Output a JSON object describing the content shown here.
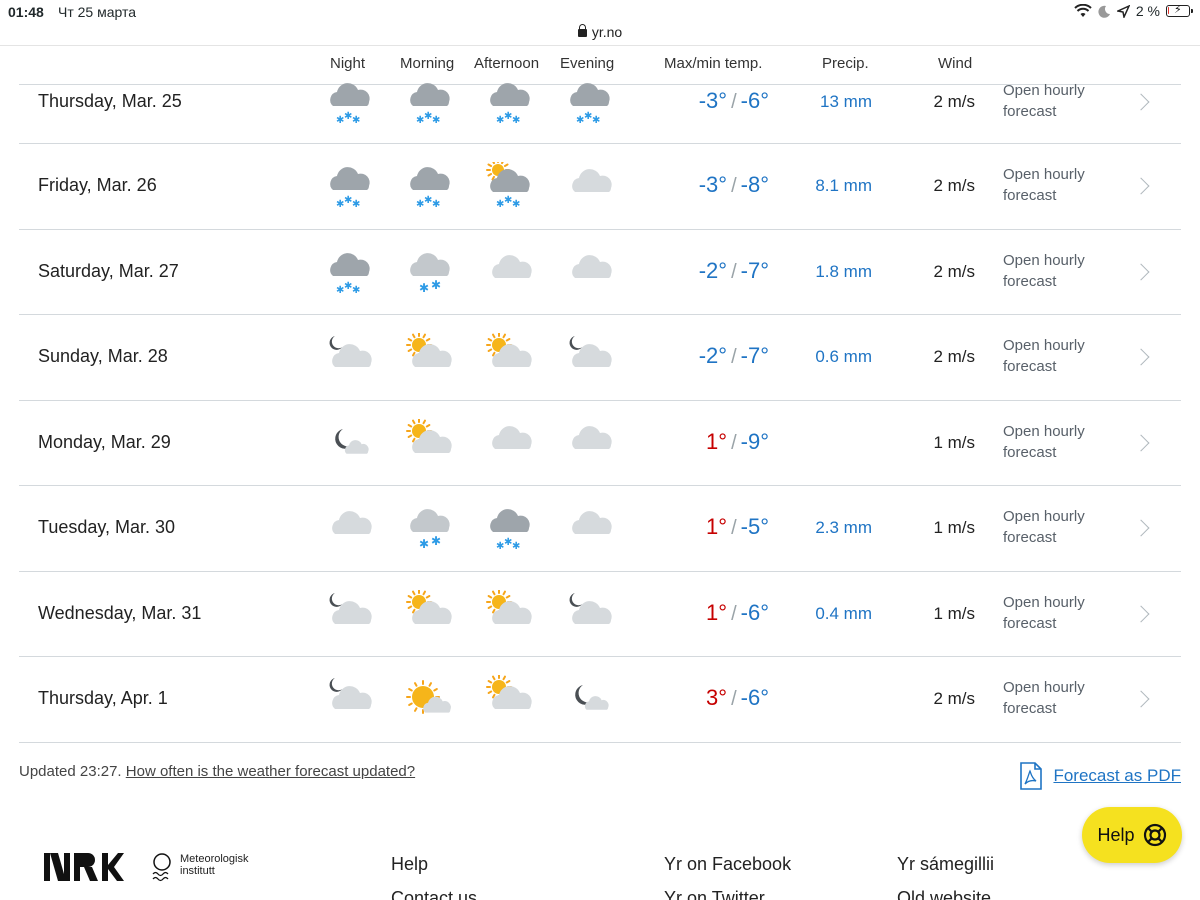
{
  "status": {
    "time": "01:48",
    "date": "Чт 25 марта",
    "battery": "2 %",
    "battery_level": 0.02,
    "url": "yr.no"
  },
  "columns": {
    "night": "Night",
    "morning": "Morning",
    "afternoon": "Afternoon",
    "evening": "Evening",
    "temp": "Max/min temp.",
    "precip": "Precip.",
    "wind": "Wind"
  },
  "rows": [
    {
      "day": "Thursday, Mar. 25",
      "icons": [
        "snow-cloud-icon",
        "snow-cloud-icon",
        "snow-cloud-icon",
        "snow-cloud-icon"
      ],
      "max": "-3°",
      "min": "-6°",
      "max_warm": false,
      "precip": "13 mm",
      "wind": "2 m/s",
      "link1": "Open hourly",
      "link2": "forecast"
    },
    {
      "day": "Friday, Mar. 26",
      "icons": [
        "snow-cloud-icon",
        "snow-cloud-icon",
        "sun-snow-cloud-icon",
        "cloud-icon"
      ],
      "max": "-3°",
      "min": "-8°",
      "max_warm": false,
      "precip": "8.1 mm",
      "wind": "2 m/s",
      "link1": "Open hourly",
      "link2": "forecast"
    },
    {
      "day": "Saturday, Mar. 27",
      "icons": [
        "snow-cloud-icon",
        "light-snow-cloud-icon",
        "cloud-icon",
        "cloud-icon"
      ],
      "max": "-2°",
      "min": "-7°",
      "max_warm": false,
      "precip": "1.8 mm",
      "wind": "2 m/s",
      "link1": "Open hourly",
      "link2": "forecast"
    },
    {
      "day": "Sunday, Mar. 28",
      "icons": [
        "moon-cloud-icon",
        "sun-cloud-icon",
        "sun-cloud-icon",
        "moon-cloud-icon"
      ],
      "max": "-2°",
      "min": "-7°",
      "max_warm": false,
      "precip": "0.6 mm",
      "wind": "2 m/s",
      "link1": "Open hourly",
      "link2": "forecast"
    },
    {
      "day": "Monday, Mar. 29",
      "icons": [
        "moon-small-cloud-icon",
        "sun-cloud-icon",
        "cloud-icon",
        "cloud-icon"
      ],
      "max": "1°",
      "min": "-9°",
      "max_warm": true,
      "precip": "",
      "wind": "1 m/s",
      "link1": "Open hourly",
      "link2": "forecast"
    },
    {
      "day": "Tuesday, Mar. 30",
      "icons": [
        "cloud-icon",
        "light-snow-cloud-icon",
        "snow-cloud-icon",
        "cloud-icon"
      ],
      "max": "1°",
      "min": "-5°",
      "max_warm": true,
      "precip": "2.3 mm",
      "wind": "1 m/s",
      "link1": "Open hourly",
      "link2": "forecast"
    },
    {
      "day": "Wednesday, Mar. 31",
      "icons": [
        "moon-cloud-icon",
        "sun-cloud-icon",
        "sun-cloud-icon",
        "moon-cloud-icon"
      ],
      "max": "1°",
      "min": "-6°",
      "max_warm": true,
      "precip": "0.4 mm",
      "wind": "1 m/s",
      "link1": "Open hourly",
      "link2": "forecast"
    },
    {
      "day": "Thursday, Apr. 1",
      "icons": [
        "moon-cloud-icon",
        "sun-small-cloud-icon",
        "sun-cloud-icon",
        "moon-small-cloud-icon"
      ],
      "max": "3°",
      "min": "-6°",
      "max_warm": true,
      "precip": "",
      "wind": "2 m/s",
      "link1": "Open hourly",
      "link2": "forecast"
    }
  ],
  "updated": {
    "text": "Updated 23:27.",
    "link": "How often is the weather forecast updated?"
  },
  "pdf": {
    "label": "Forecast as PDF"
  },
  "help": {
    "label": "Help"
  },
  "footer": {
    "met_line1": "Meteorologisk",
    "met_line2": "institutt",
    "col1": [
      "Help",
      "Contact us"
    ],
    "col2": [
      "Yr on Facebook",
      "Yr on Twitter"
    ],
    "col3": [
      "Yr sámegillii",
      "Old website"
    ]
  },
  "colors": {
    "accent": "#1f74c4",
    "warm": "#c60000",
    "help_bg": "#f5e11f"
  }
}
